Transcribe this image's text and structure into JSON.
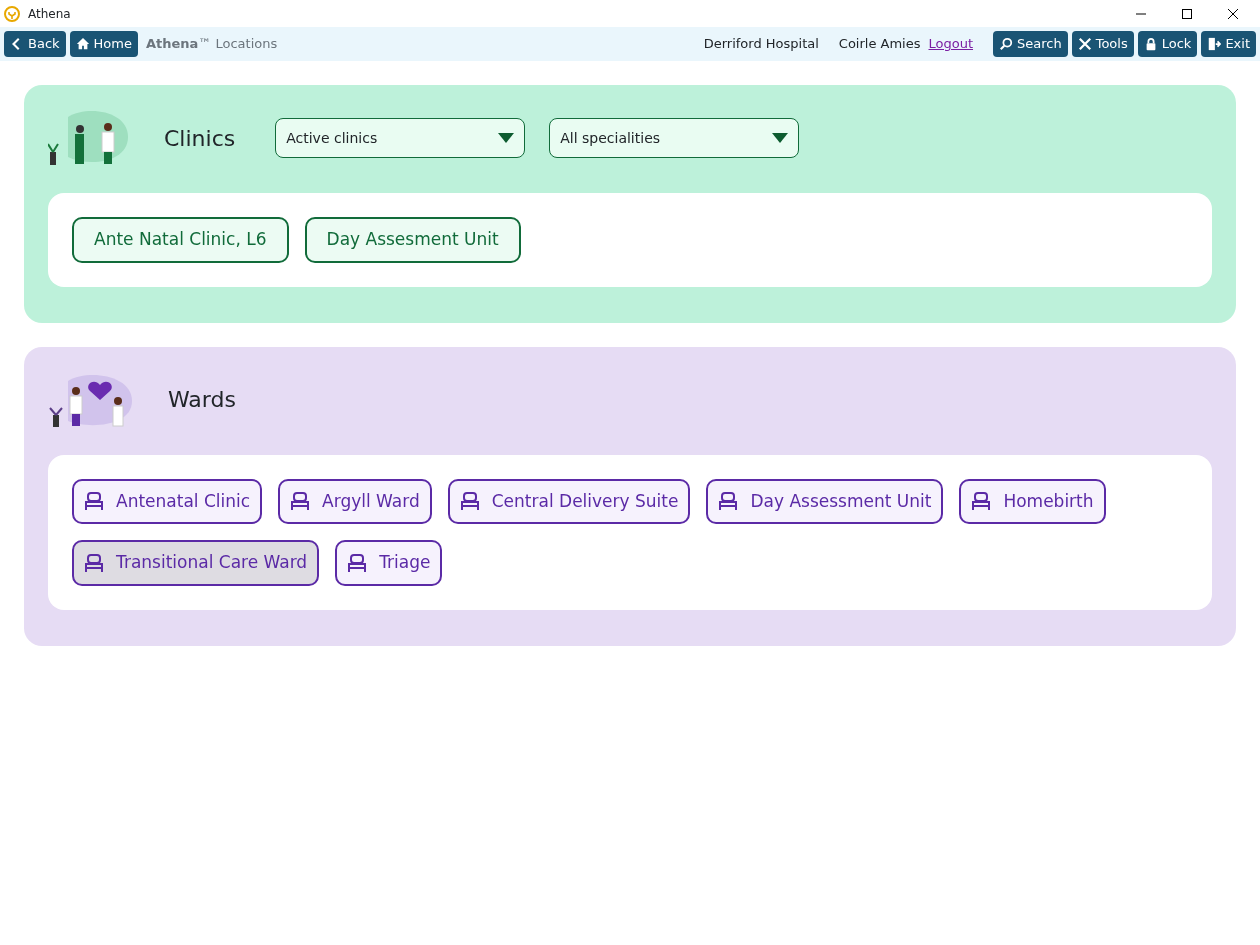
{
  "window": {
    "title": "Athena"
  },
  "toolbar": {
    "left_buttons": [
      {
        "kind": "back",
        "label": "Back"
      },
      {
        "kind": "home",
        "label": "Home"
      }
    ],
    "page_title": "**Athena**™ Locations",
    "hospital": "Derriford Hospital",
    "user": "Coirle Amies",
    "logout": "Logout",
    "right_buttons": [
      {
        "kind": "search",
        "label": "Search"
      },
      {
        "kind": "tools",
        "label": "Tools"
      },
      {
        "kind": "lock",
        "label": "Lock"
      },
      {
        "kind": "exit",
        "label": "Exit"
      }
    ]
  },
  "clinics": {
    "title": "Clinics",
    "filters": [
      {
        "value": "Active clinics"
      },
      {
        "value": "All specialities"
      }
    ],
    "items": [
      {
        "label": "Ante Natal Clinic, L6"
      },
      {
        "label": "Day Assesment Unit"
      }
    ]
  },
  "wards": {
    "title": "Wards",
    "items": [
      {
        "label": "Antenatal Clinic",
        "selected": false
      },
      {
        "label": "Argyll Ward",
        "selected": false
      },
      {
        "label": "Central Delivery Suite",
        "selected": false
      },
      {
        "label": "Day Assessment Unit",
        "selected": false
      },
      {
        "label": "Homebirth",
        "selected": false
      },
      {
        "label": "Transitional Care Ward",
        "selected": true
      },
      {
        "label": "Triage",
        "selected": false
      }
    ]
  }
}
